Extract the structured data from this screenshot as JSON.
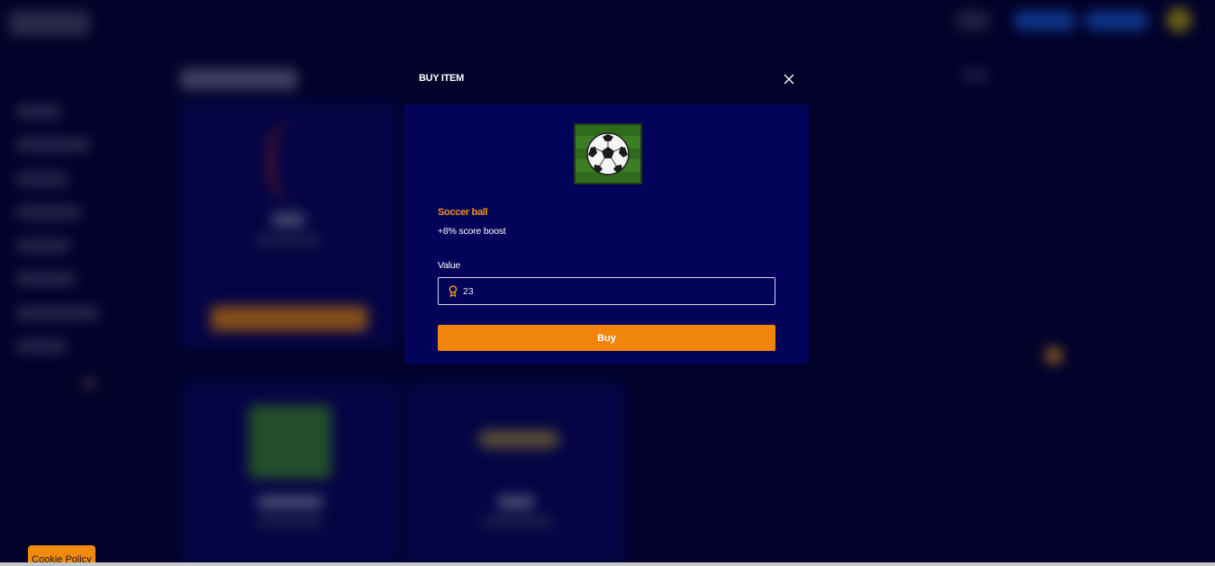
{
  "modal": {
    "title": "BUY ITEM",
    "close_icon": "close-icon",
    "item": {
      "image_icon": "soccer-ball-icon",
      "name": "Soccer ball",
      "description": "+8% score boost"
    },
    "value_label": "Value",
    "value_input": {
      "value": "23",
      "icon": "trophy-icon"
    },
    "buy_label": "Buy"
  },
  "footer": {
    "cookie_policy_label": "Cookie Policy"
  },
  "colors": {
    "background": "#02022a",
    "panel": "#03035a",
    "accent": "#f0850a",
    "item_name": "#f0940f"
  }
}
